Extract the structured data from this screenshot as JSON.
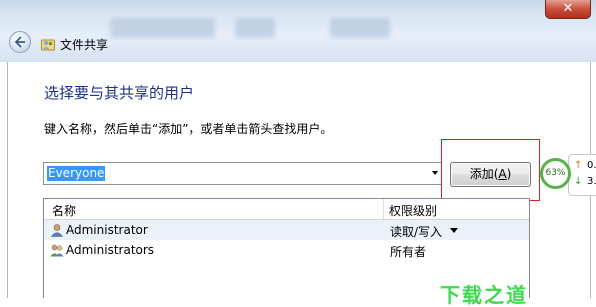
{
  "window": {
    "title": "文件共享",
    "close_glyph": "✕"
  },
  "main": {
    "heading": "选择要与其共享的用户",
    "instruction": "键入名称，然后单击“添加”，或者单击箭头查找用户。",
    "combo_value": "Everyone",
    "add_button": {
      "label": "添加(",
      "accel": "A",
      "suffix": ")"
    }
  },
  "list": {
    "headers": {
      "name": "名称",
      "permission": "权限级别"
    },
    "rows": [
      {
        "name": "Administrator",
        "permission": "读取/写入"
      },
      {
        "name": "Administrators",
        "permission": "所有者"
      }
    ]
  },
  "net_widget": {
    "percent": "63%",
    "up_arrow": "↑",
    "down_arrow": "↓",
    "up_value": "0.",
    "down_value": "3."
  },
  "watermark": "下载之道",
  "colors": {
    "heading": "#1e3287",
    "selection": "#3399ff",
    "highlight_box": "#e02020",
    "net_ring": "#5ab04a"
  }
}
